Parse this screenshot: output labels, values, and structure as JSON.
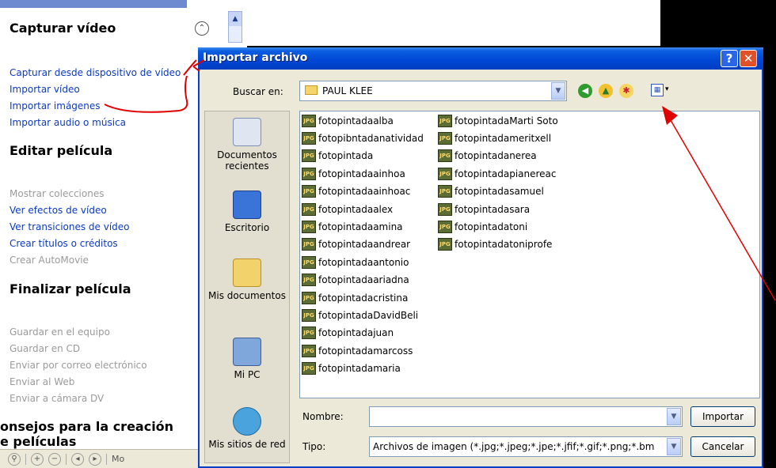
{
  "tasks_pane": {
    "capture_title": "Capturar vídeo",
    "capture_links": [
      "Capturar desde dispositivo de vídeo",
      "Importar vídeo",
      "Importar imágenes",
      "Importar audio o música"
    ],
    "edit_title": "Editar película",
    "edit_links": [
      "Mostrar colecciones",
      "Ver efectos de vídeo",
      "Ver transiciones de vídeo",
      "Crear títulos o créditos",
      "Crear AutoMovie"
    ],
    "finish_title": "Finalizar película",
    "finish_links": [
      "Guardar en el equipo",
      "Guardar en CD",
      "Enviar por correo electrónico",
      "Enviar al Web",
      "Enviar a cámara DV"
    ],
    "tips_title_1": "onsejos para la creación",
    "tips_title_2": "e películas",
    "bottom_label": "Mo"
  },
  "dialog": {
    "title": "Importar archivo",
    "help_label": "?",
    "close_label": "✕",
    "lookin_label": "Buscar en:",
    "lookin_value": "PAUL KLEE",
    "places": [
      "Documentos recientes",
      "Escritorio",
      "Mis documentos",
      "Mi PC",
      "Mis sitios de red"
    ],
    "files_col1": [
      "fotopintadaalba",
      "fotopibntadanatividad",
      "fotopintada",
      "fotopintadaainhoa",
      "fotopintadaainhoac",
      "fotopintadaalex",
      "fotopintadaamina",
      "fotopintadaandrear",
      "fotopintadaantonio",
      "fotopintadaariadna",
      "fotopintadacristina",
      "fotopintadaDavidBeli",
      "fotopintadajuan",
      "fotopintadamarcoss",
      "fotopintadamaria"
    ],
    "files_col2": [
      "fotopintadaMarti Soto",
      "fotopintadameritxell",
      "fotopintadanerea",
      "fotopintadapianereac",
      "fotopintadasamuel",
      "fotopintadasara",
      "fotopintadatoni",
      "fotopintadatoniprofe"
    ],
    "file_icon_text": "JPG",
    "name_label": "Nombre:",
    "name_value": "",
    "type_label": "Tipo:",
    "type_value": "Archivos de imagen (*.jpg;*.jpeg;*.jpe;*.jfif;*.gif;*.png;*.bm",
    "import_button": "Importar",
    "cancel_button": "Cancelar"
  },
  "colors": {
    "title_blue": "#0046d5",
    "link_blue": "#0b3ac1",
    "annotation_red": "#e00000"
  }
}
